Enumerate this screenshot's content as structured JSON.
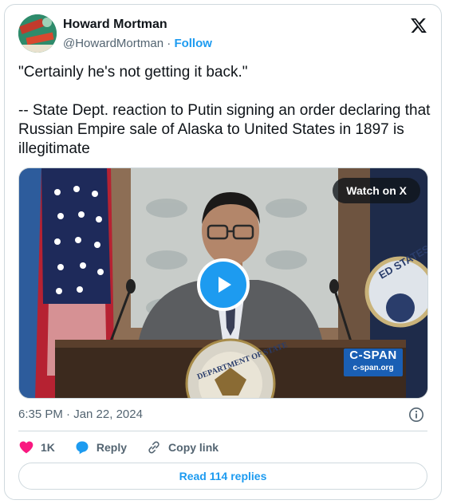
{
  "author": {
    "name": "Howard Mortman",
    "handle": "@HowardMortman",
    "separator": "·",
    "follow_label": "Follow"
  },
  "tweet": {
    "text": "\"Certainly he's not getting it back.\"\n\n-- State Dept. reaction to Putin signing an order declaring that Russian Empire sale of Alaska to United States in 1897 is illegitimate"
  },
  "media": {
    "watch_label": "Watch on X",
    "cspan_logo": "C-SPAN",
    "cspan_url": "c-span.org",
    "seal_text": "DEPARTMENT OF STATE",
    "seal_partial": "ED STATES"
  },
  "meta": {
    "timestamp": "6:35 PM · Jan 22, 2024"
  },
  "actions": {
    "likes": "1K",
    "reply_label": "Reply",
    "copy_label": "Copy link"
  },
  "replies": {
    "label": "Read 114 replies"
  },
  "colors": {
    "accent": "#1d9bf0",
    "like": "#f91880",
    "secondary_text": "#536471"
  }
}
